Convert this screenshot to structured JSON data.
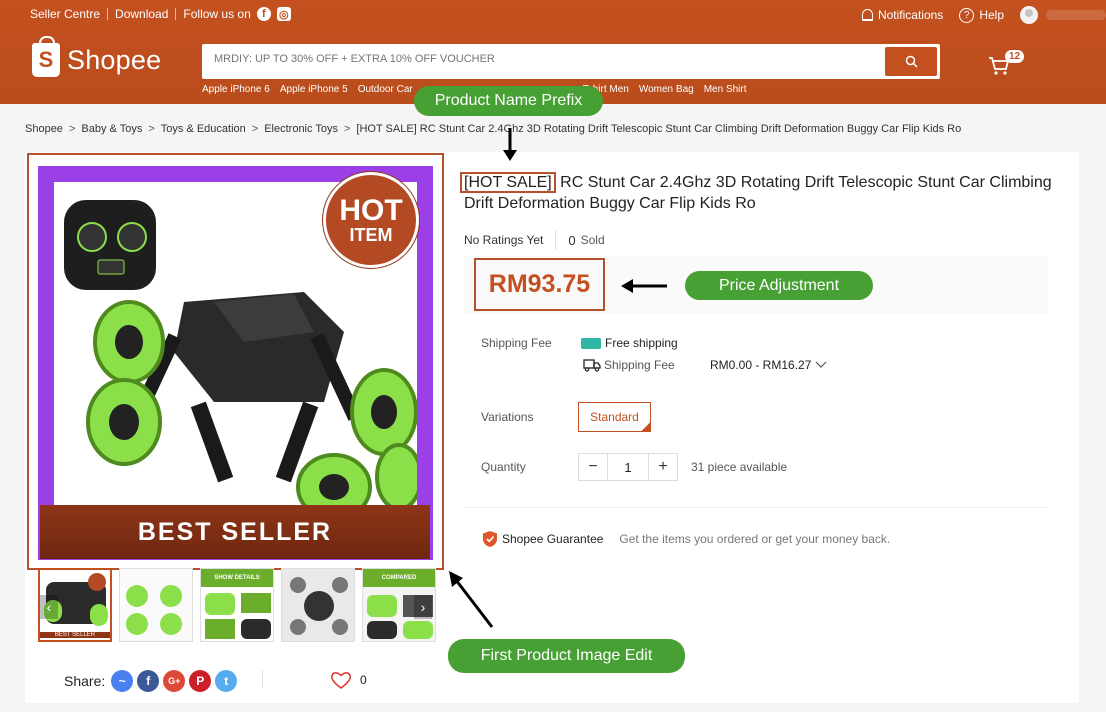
{
  "topbar": {
    "links": [
      "Seller Centre",
      "Download",
      "Follow us on"
    ],
    "notifications": "Notifications",
    "help": "Help"
  },
  "logo": {
    "text": "Shopee",
    "glyph": "S"
  },
  "search": {
    "placeholder": "MRDIY: UP TO 30% OFF + EXTRA 10% OFF VOUCHER",
    "hints": [
      "Apple iPhone 6",
      "Apple iPhone 5",
      "Outdoor Car",
      "Tshirt Men",
      "Women Bag",
      "Men Shirt"
    ]
  },
  "cart": {
    "count": "12"
  },
  "breadcrumb": [
    "Shopee",
    "Baby & Toys",
    "Toys & Education",
    "Electronic Toys",
    "[HOT SALE] RC Stunt Car 2.4Ghz 3D Rotating Drift Telescopic Stunt Car Climbing Drift Deformation Buggy Car Flip Kids Ro"
  ],
  "product": {
    "title_prefix": "[HOT SALE]",
    "title_rest": " RC Stunt Car 2.4Ghz 3D Rotating Drift Telescopic Stunt Car Climbing Drift Deformation Buggy Car Flip Kids Ro",
    "ratings": "No Ratings Yet",
    "sold_count": "0",
    "sold_label": "Sold",
    "price": "RM93.75",
    "shipping_label": "Shipping Fee",
    "free_shipping": "Free shipping",
    "shipping_fee_label": "Shipping Fee",
    "shipping_range": "RM0.00 - RM16.27",
    "variations_label": "Variations",
    "variation_option": "Standard",
    "quantity_label": "Quantity",
    "quantity_value": "1",
    "available": "31 piece available",
    "guarantee_title": "Shopee Guarantee",
    "guarantee_text": "Get the items you ordered or get your money back."
  },
  "image": {
    "hot_line1": "HOT",
    "hot_line2": "ITEM",
    "banner": "BEST SELLER",
    "thumbs": [
      {
        "top": "",
        "bottom": "BEST SELLER"
      },
      {
        "top": "",
        "bottom": ""
      },
      {
        "top": "SHOW DETAILS",
        "bottom": ""
      },
      {
        "top": "",
        "bottom": ""
      },
      {
        "top": "COMPARED",
        "bottom": ""
      }
    ]
  },
  "share": {
    "label": "Share:",
    "likes": "0"
  },
  "annotations": {
    "prefix": "Product Name Prefix",
    "price": "Price Adjustment",
    "image": "First Product Image Edit"
  },
  "colors": {
    "brand": "#c4501f",
    "annotation": "#46a033",
    "highlight": "#b5512b",
    "image_frame": "#9b3fe6"
  }
}
